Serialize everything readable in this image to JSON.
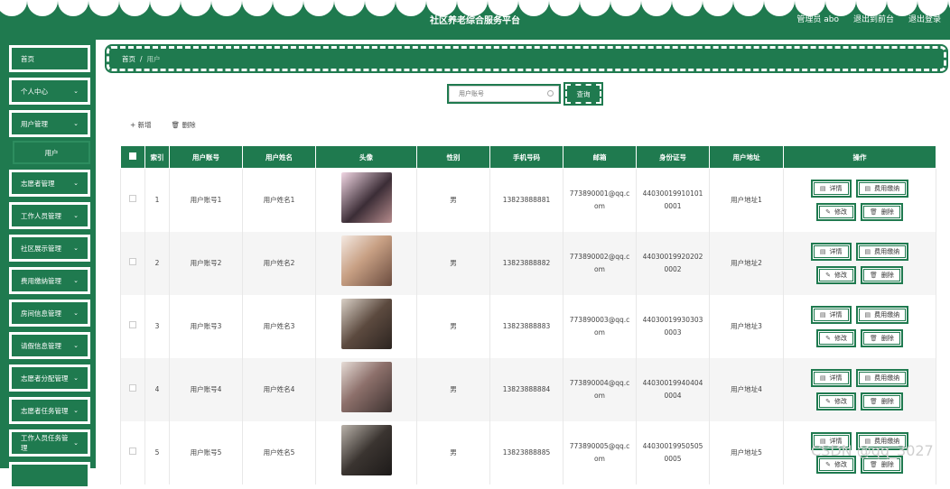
{
  "header": {
    "title": "社区养老综合服务平台",
    "admin_label": "管理员 abo",
    "front_link": "退出到前台",
    "logout_link": "退出登录"
  },
  "sidebar": {
    "items": [
      {
        "label": "首页",
        "has_chevron": false
      },
      {
        "label": "个人中心",
        "has_chevron": true
      },
      {
        "label": "用户管理",
        "has_chevron": true,
        "expanded": true,
        "sub": [
          "用户"
        ]
      },
      {
        "label": "志愿者管理",
        "has_chevron": true
      },
      {
        "label": "工作人员管理",
        "has_chevron": true
      },
      {
        "label": "社区展示管理",
        "has_chevron": true
      },
      {
        "label": "费用缴纳管理",
        "has_chevron": true
      },
      {
        "label": "房间信息管理",
        "has_chevron": true
      },
      {
        "label": "请假信息管理",
        "has_chevron": true
      },
      {
        "label": "志愿者分配管理",
        "has_chevron": true
      },
      {
        "label": "志愿者任务管理",
        "has_chevron": true
      },
      {
        "label": "工作人员任务管理",
        "has_chevron": true
      },
      {
        "label": "",
        "has_chevron": false
      }
    ]
  },
  "breadcrumb": {
    "home": "首页",
    "sep": "/",
    "current": "用户"
  },
  "search": {
    "placeholder": "用户账号",
    "button": "查询"
  },
  "actions": {
    "add": "+ 新增",
    "delete": "🗑 删除"
  },
  "table": {
    "headers": [
      "",
      "索引",
      "用户账号",
      "用户姓名",
      "头像",
      "性别",
      "手机号码",
      "邮箱",
      "身份证号",
      "用户地址",
      "操作"
    ],
    "rows": [
      {
        "index": "1",
        "account": "用户账号1",
        "name": "用户姓名1",
        "gender": "男",
        "phone": "13823888881",
        "email_a": "773890001@qq.c",
        "email_b": "om",
        "id_a": "44030019910101",
        "id_b": "0001",
        "address": "用户地址1"
      },
      {
        "index": "2",
        "account": "用户账号2",
        "name": "用户姓名2",
        "gender": "男",
        "phone": "13823888882",
        "email_a": "773890002@qq.c",
        "email_b": "om",
        "id_a": "44030019920202",
        "id_b": "0002",
        "address": "用户地址2"
      },
      {
        "index": "3",
        "account": "用户账号3",
        "name": "用户姓名3",
        "gender": "男",
        "phone": "13823888883",
        "email_a": "773890003@qq.c",
        "email_b": "om",
        "id_a": "44030019930303",
        "id_b": "0003",
        "address": "用户地址3"
      },
      {
        "index": "4",
        "account": "用户账号4",
        "name": "用户姓名4",
        "gender": "男",
        "phone": "13823888884",
        "email_a": "773890004@qq.c",
        "email_b": "om",
        "id_a": "44030019940404",
        "id_b": "0004",
        "address": "用户地址4"
      },
      {
        "index": "5",
        "account": "用户账号5",
        "name": "用户姓名5",
        "gender": "男",
        "phone": "13823888885",
        "email_a": "773890005@qq.c",
        "email_b": "om",
        "id_a": "44030019950505",
        "id_b": "0005",
        "address": "用户地址5"
      }
    ],
    "ops": {
      "detail": "详情",
      "pay": "费用缴纳",
      "edit": "修改",
      "remove": "删除"
    }
  },
  "watermark": "CSDN @qq_3027",
  "colors": {
    "primary": "#1f7a4f",
    "header_bg": "#1f7a4f"
  },
  "icons": {
    "detail": "document-icon",
    "pay": "document-icon",
    "edit": "pencil-icon",
    "remove": "trash-icon"
  }
}
